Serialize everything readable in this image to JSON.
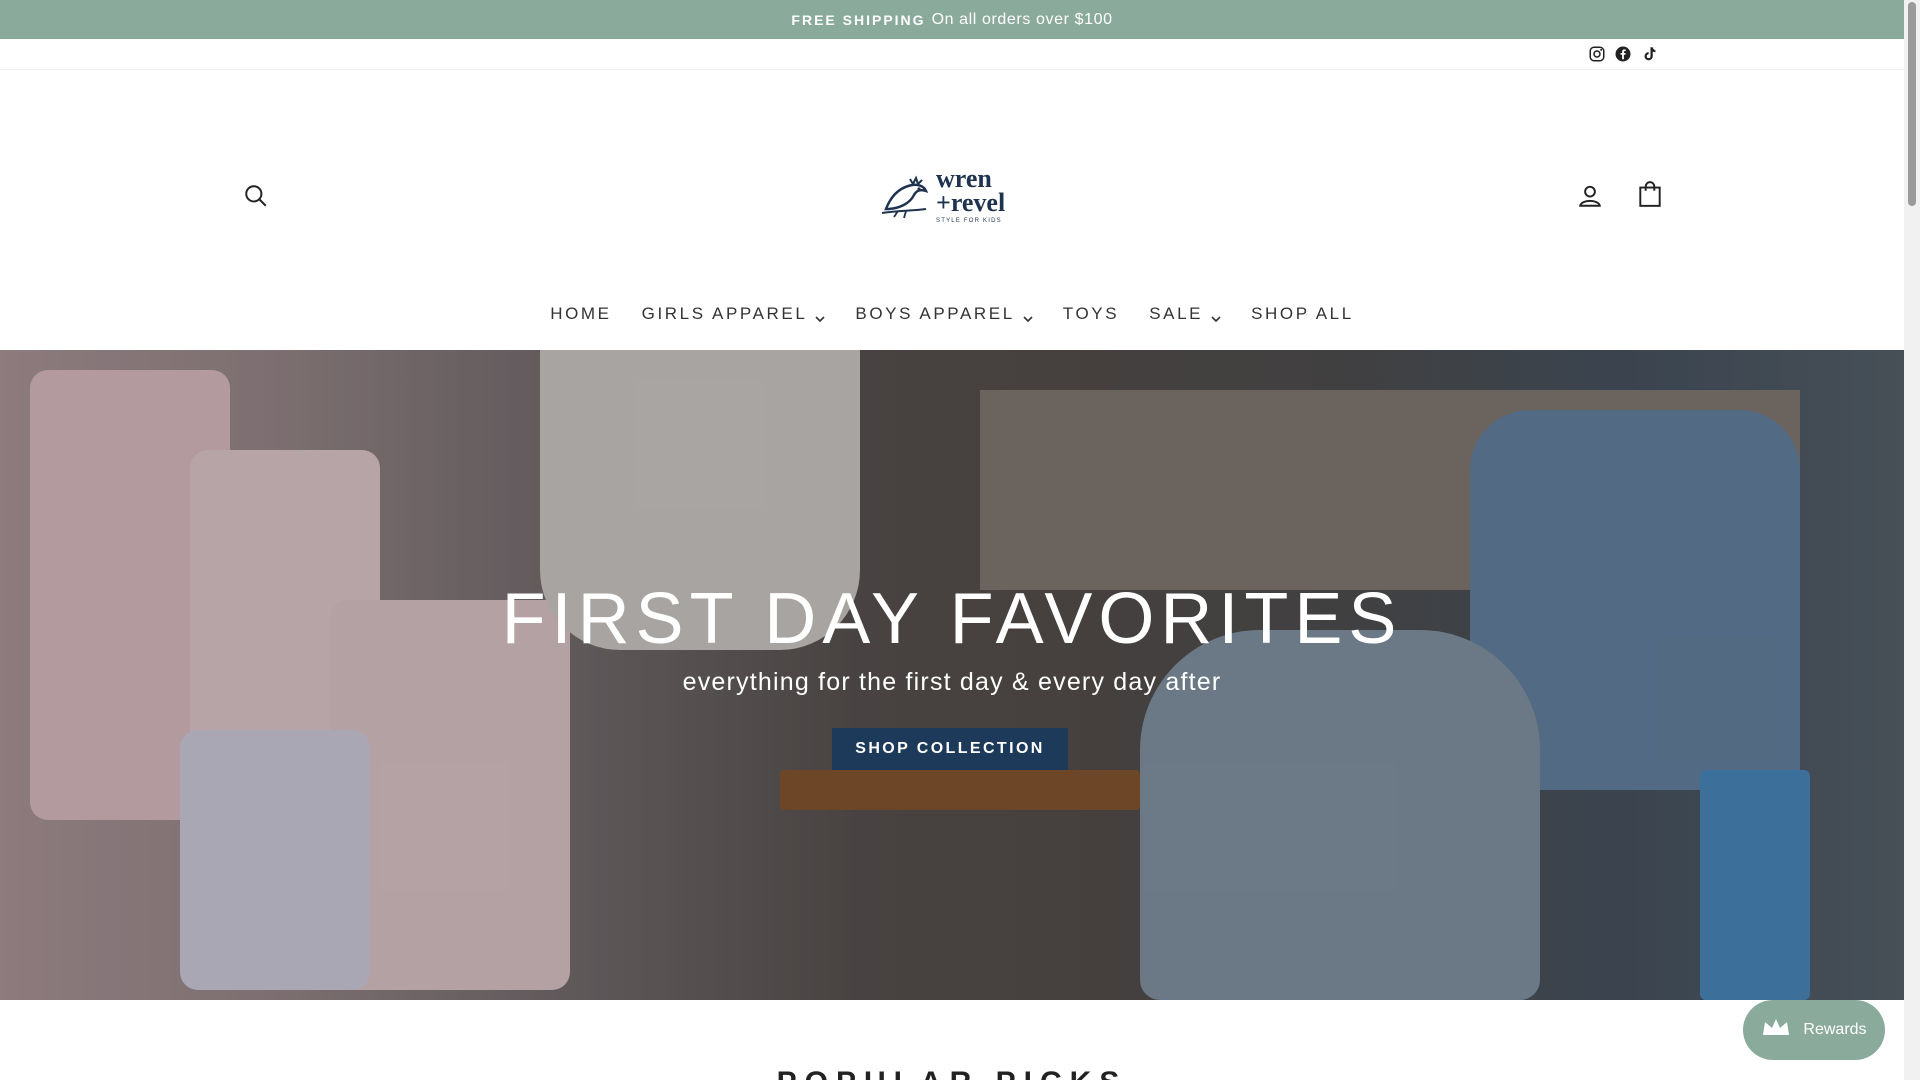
{
  "announcement": {
    "bold": "FREE SHIPPING",
    "text": "On all orders over $100",
    "bg": "#8aaa9b"
  },
  "social": {
    "icons": [
      "instagram-icon",
      "facebook-icon",
      "tiktok-icon"
    ]
  },
  "header": {
    "logo_line1": "wren",
    "logo_line2": "+revel",
    "logo_tagline": "STYLE FOR KIDS",
    "icons": [
      "search-icon",
      "account-icon",
      "bag-icon"
    ]
  },
  "nav": {
    "items": [
      {
        "label": "HOME"
      },
      {
        "label": "GIRLS APPAREL"
      },
      {
        "label": "BOYS APPAREL"
      },
      {
        "label": "TOYS"
      },
      {
        "label": "SALE"
      },
      {
        "label": "SHOP ALL"
      }
    ]
  },
  "hero": {
    "title": "FIRST DAY FAVORITES",
    "subtitle": "everything for the first day & every day after",
    "button": "SHOP COLLECTION",
    "button_color": "#1e3a5a"
  },
  "section": {
    "title": "POPULAR PICKS"
  },
  "rewards": {
    "label": "Rewards",
    "icon": "crown-icon"
  }
}
